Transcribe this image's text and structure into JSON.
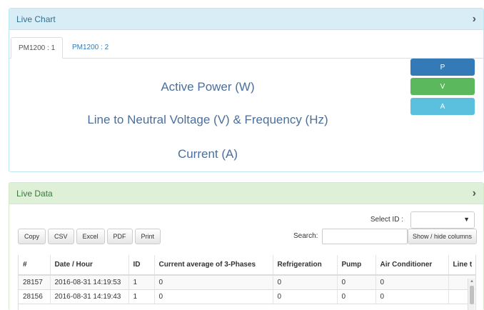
{
  "live_chart": {
    "title": "Live Chart",
    "tabs": [
      "PM1200 : 1",
      "PM1200 : 2"
    ],
    "chart_titles": [
      "Active Power (W)",
      "Line to Neutral Voltage (V) & Frequency (Hz)",
      "Current (A)"
    ],
    "buttons": {
      "p": "P",
      "v": "V",
      "a": "A"
    },
    "colors": {
      "p": "#337ab7",
      "v": "#5cb85c",
      "a": "#5bc0de",
      "heading_bg": "#d9edf7"
    }
  },
  "live_data": {
    "title": "Live Data",
    "select_label": "Select ID :",
    "export_buttons": [
      "Copy",
      "CSV",
      "Excel",
      "PDF",
      "Print"
    ],
    "search_label": "Search:",
    "show_hide_label": "Show / hide columns",
    "table": {
      "columns": [
        "#",
        "Date / Hour",
        "ID",
        "Current average of 3-Phases",
        "Refrigeration",
        "Pump",
        "Air Conditioner",
        "Line t"
      ],
      "rows": [
        [
          "28157",
          "2016-08-31 14:19:53",
          "1",
          "0",
          "0",
          "0",
          "0",
          ""
        ],
        [
          "28156",
          "2016-08-31 14:19:43",
          "1",
          "0",
          "0",
          "0",
          "0",
          ""
        ]
      ]
    },
    "colors": {
      "heading_bg": "#dff0d8"
    }
  }
}
